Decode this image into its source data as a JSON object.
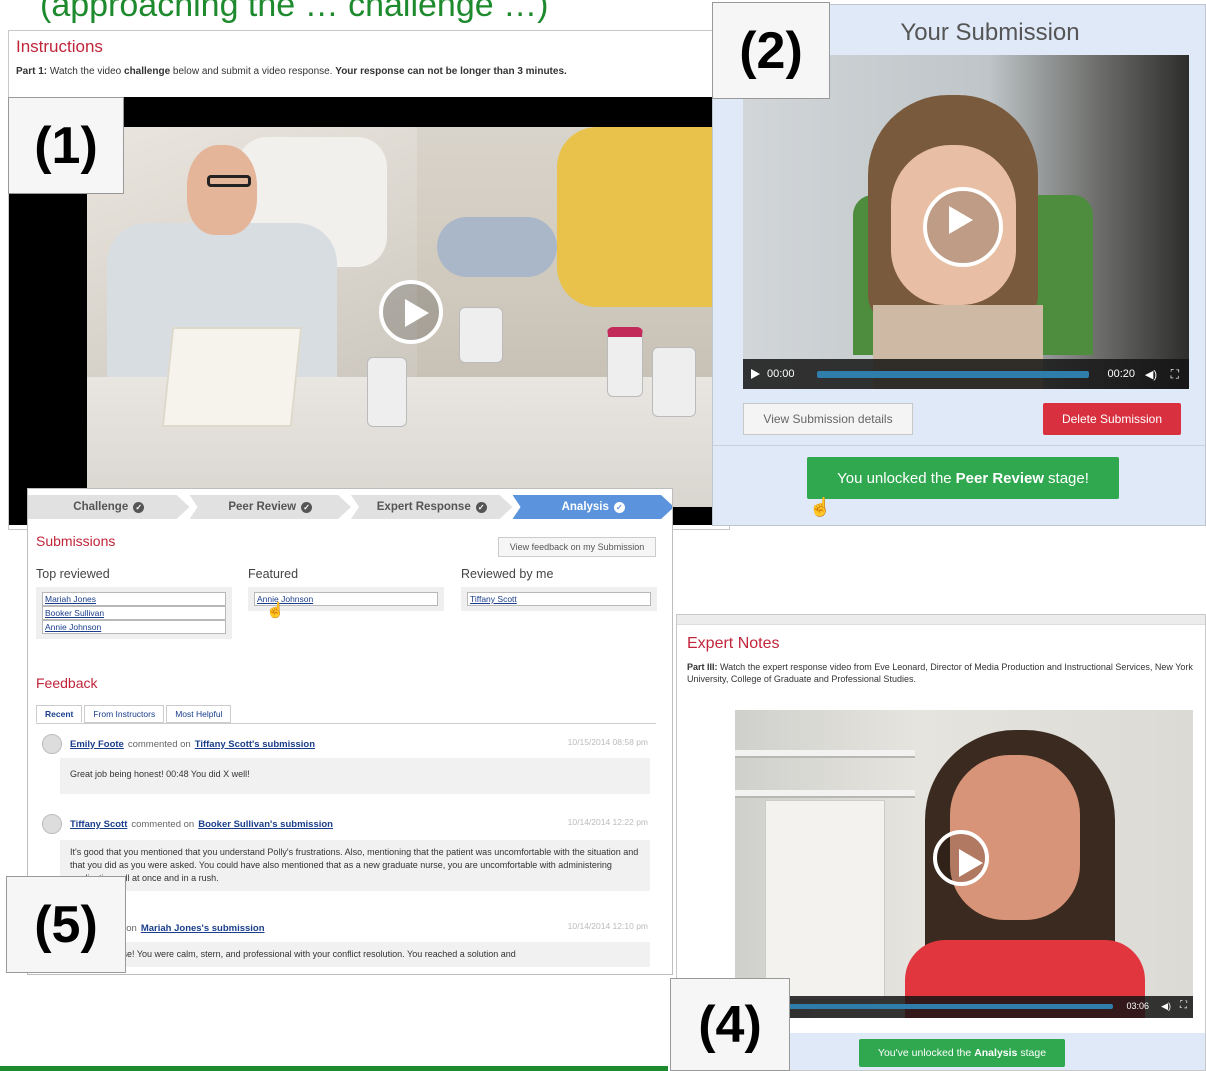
{
  "header_partial": "(approaching the … challenge …)",
  "labels": {
    "l1": "(1)",
    "l2": "(2)",
    "l4": "(4)",
    "l5": "(5)"
  },
  "panel1": {
    "instructions_title": "Instructions",
    "part_label": "Part 1:",
    "text_a": " Watch the video ",
    "text_b": "challenge",
    "text_c": " below and submit a video response. ",
    "text_d": "Your response can not be longer than 3 minutes."
  },
  "panel2": {
    "title": "Your Submission",
    "time_current": "00:00",
    "time_total": "00:20",
    "view_button": "View Submission details",
    "delete_button": "Delete Submission",
    "unlock_prefix": "You unlocked the",
    "unlock_bold": "Peer Review",
    "unlock_suffix": "stage!"
  },
  "panel4": {
    "title": "Expert Notes",
    "part_label": "Part III:",
    "text": " Watch the expert response video from Eve Leonard, Director of Media Production and Instructional Services, New York University, College of Graduate and Professional Studies.",
    "time_total": "03:06",
    "unlock_prefix": "You've unlocked the",
    "unlock_bold": "Analysis",
    "unlock_suffix": "stage"
  },
  "panel5": {
    "steps": [
      "Challenge",
      "Peer Review",
      "Expert Response",
      "Analysis"
    ],
    "submissions_title": "Submissions",
    "view_feedback_button": "View feedback on my Submission",
    "col_top": "Top reviewed",
    "col_featured": "Featured",
    "col_reviewed": "Reviewed by me",
    "top_reviewed": [
      "Mariah Jones",
      "Booker Sullivan",
      "Annie Johnson"
    ],
    "featured": [
      "Annie Johnson"
    ],
    "reviewed_by_me": [
      "Tiffany Scott"
    ],
    "feedback_title": "Feedback",
    "tabs": [
      "Recent",
      "From Instructors",
      "Most Helpful"
    ],
    "comments": [
      {
        "author": "Emily Foote",
        "mid": "commented on",
        "target": "Tiffany Scott's submission",
        "time": "10/15/2014 08:58 pm",
        "body": "Great job being honest! 00:48 You did X well!"
      },
      {
        "author": "Tiffany Scott",
        "mid": "commented on",
        "target": "Booker Sullivan's submission",
        "time": "10/14/2014 12:22 pm",
        "body": "It's good that you mentioned that you understand Polly's frustrations. Also, mentioning that the patient was uncomfortable with the situation and that you did as you were asked. You could have also mentioned that as a new graduate nurse, you are uncomfortable with administering medications all at once and in a rush."
      },
      {
        "author": "",
        "mid": "commented on",
        "target": "Mariah Jones's submission",
        "time": "10/14/2014 12:10 pm",
        "body": "Great response! You were calm, stern, and professional with your conflict resolution. You reached a solution and"
      }
    ]
  }
}
